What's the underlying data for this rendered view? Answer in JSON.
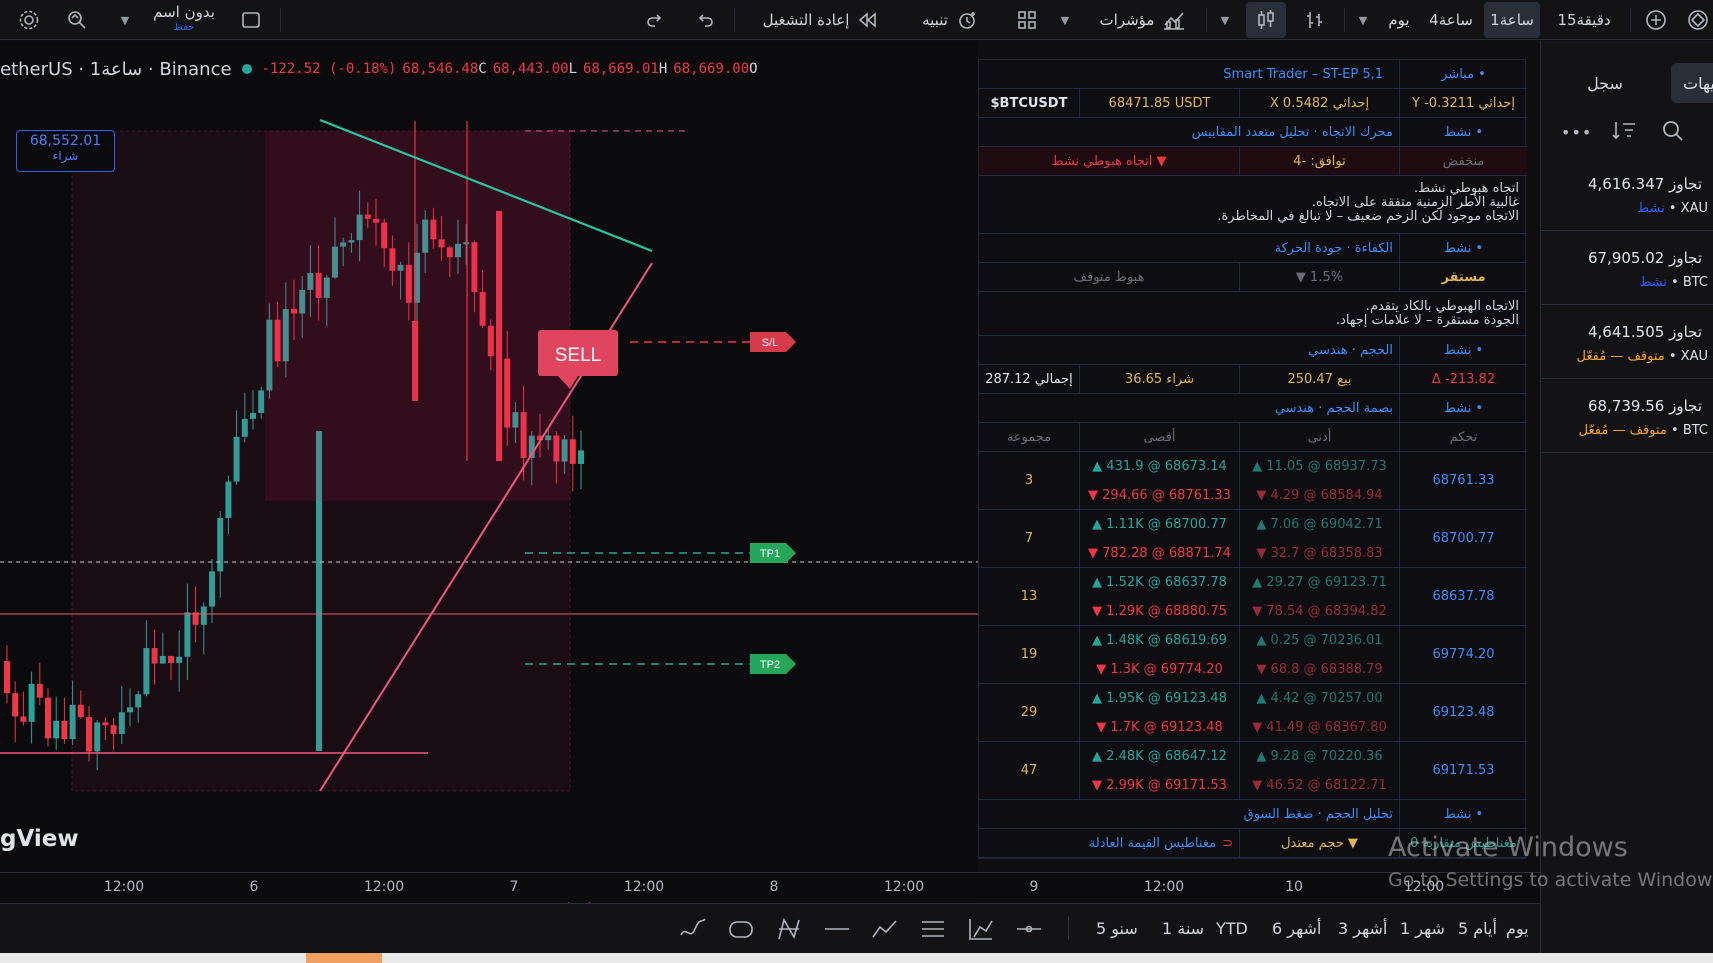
{
  "toolbar": {
    "layout_name": "بدون اسم",
    "layout_sub": "حفظ",
    "replay": "إعادة التشغيل",
    "alert": "تنبيه",
    "indicators": "مؤشرات",
    "intervals": [
      "15دقيقة",
      "1ساعة",
      "4ساعة",
      "يوم"
    ],
    "active_interval": "1ساعة"
  },
  "legend": {
    "symbol": "etherUS · 1ساعة · Binance",
    "change": "-122.52 (-0.18%)",
    "close_val": "68,546.48",
    "close_lbl": "C",
    "low_val": "68,443.00",
    "low_lbl": "L",
    "high_val": "68,669.01",
    "high_lbl": "H",
    "open_val": "68,669.00",
    "open_lbl": "O",
    "price_tag_value": "68,552.01",
    "price_tag_label": "شراء"
  },
  "chart_labels": {
    "sell": "SELL",
    "sl": "S/L",
    "tp1": "TP1",
    "tp2": "TP2",
    "logo": "gView"
  },
  "time_axis": [
    "12:00",
    "6",
    "12:00",
    "7",
    "12:00",
    "8",
    "12:00",
    "9",
    "12:00",
    "10",
    "12:00"
  ],
  "dashboard": {
    "title": "Smart Trader – ST-EP 5,1",
    "live": "مباشر •",
    "symbol": "$BTCUSDT",
    "price": "68471.85 USDT",
    "x_coord": "X 0.5482 إحداثي",
    "y_coord": "Y -0.3211 إحداثي",
    "engine_label": "محرك الاتجاه · تحليل متعدد المقاييس",
    "active": "نشط •",
    "low_state": "منخفض",
    "consensus": "توافق: -4",
    "trend_state": "اتجاه هبوطي نشط ▼",
    "note1": [
      ".اتجاه هبوطي نشط",
      ".غالبية الأطر الزمنية متفقة على الاتجاه",
      ".الاتجاه موجود لكن الزخم ضعيف – لا تبالغ في المخاطرة"
    ],
    "efficiency_label": "الكفاءة · جودة الحركة",
    "stable": "مستقر",
    "eff_pct": "▼ 1.5%",
    "eff_state": "هبوط متوقف",
    "note2": [
      ".الاتجاه الهبوطي بالكاد يتقدم",
      ".الجودة مستقرة – لا علامات إجهاد"
    ],
    "volume_label": "الحجم · هندسي",
    "delta": "Δ -213.82",
    "sell_vol": "بيع 250.47",
    "buy_vol": "شراء 36.65",
    "total_vol": "إجمالي 287.12",
    "footprint_label": "بصمة الحجم · هندسي",
    "headers": [
      "تحكم",
      "أدنى",
      "أقصى",
      "مجموعة"
    ],
    "rows": [
      {
        "control": "68761.33",
        "min_up": "▲ 11.05 @ 68937.73",
        "min_dn": "▼ 4.29 @ 68584.94",
        "max_up": "▲ 431.9 @ 68673.14",
        "max_dn": "▼ 294.66 @ 68761.33",
        "group": "3"
      },
      {
        "control": "68700.77",
        "min_up": "▲ 7.06 @ 69042.71",
        "min_dn": "▼ 32.7 @ 68358.83",
        "max_up": "▲ 1.11K @ 68700.77",
        "max_dn": "▼ 782.28 @ 68871.74",
        "group": "7"
      },
      {
        "control": "68637.78",
        "min_up": "▲ 29.27 @ 69123.71",
        "min_dn": "▼ 78.54 @ 68394.82",
        "max_up": "▲ 1.52K @ 68637.78",
        "max_dn": "▼ 1.29K @ 68880.75",
        "group": "13"
      },
      {
        "control": "69774.20",
        "min_up": "▲ 0.25 @ 70236.01",
        "min_dn": "▼ 68.8 @ 68388.79",
        "max_up": "▲ 1.48K @ 68619.69",
        "max_dn": "▼ 1.3K @ 69774.20",
        "group": "19"
      },
      {
        "control": "69123.48",
        "min_up": "▲ 4.42 @ 70257.00",
        "min_dn": "▼ 41.49 @ 68367.80",
        "max_up": "▲ 1.95K @ 69123.48",
        "max_dn": "▼ 1.7K @ 69123.48",
        "group": "29"
      },
      {
        "control": "69171.53",
        "min_up": "▲ 9.28 @ 70220.36",
        "min_dn": "▼ 46.52 @ 68122.71",
        "max_up": "▲ 2.48K @ 68647.12",
        "max_dn": "▼ 2.99K @ 69171.53",
        "group": "47"
      }
    ],
    "vol_analysis": "تحليل الحجم · ضغط السوق",
    "moderate_vol": "حجم معتدل ▼",
    "fvg": "مغناطيس القيمة العادلة",
    "fvg_count": "0 مغناطيس متقاربة"
  },
  "watchlist": {
    "tab_log": "سجل",
    "tab_other": "تنبيهات",
    "items": [
      {
        "title": "تجاوز 4,616.347",
        "sym": "XAU",
        "status": "نشط",
        "status_color": "#2962ff"
      },
      {
        "title": "تجاوز 67,905.02",
        "sym": "BTC",
        "status": "نشط",
        "status_color": "#2962ff"
      },
      {
        "title": "تجاوز 4,641.505",
        "sym": "XAU",
        "status": "متوقف — مُفعّل",
        "status_color": "#f5a623"
      },
      {
        "title": "تجاوز 68,739.56",
        "sym": "BTC",
        "status": "متوقف — مُفعّل",
        "status_color": "#f5a623"
      }
    ]
  },
  "bottombar": {
    "ranges": [
      "يوم",
      "5 أيام",
      "1 شهر",
      "3 أشهر",
      "6 أشهر",
      "YTD",
      "1 سنة",
      "5 سنو"
    ]
  },
  "windows": {
    "activate": "Activate Windows",
    "settings": "Go to Settings to activate Windows."
  },
  "colors": {
    "up": "#26a69a",
    "down": "#f23645",
    "accent": "#2962ff",
    "trendline_green": "#26c6a0",
    "trendline_pink": "#f0567e"
  }
}
